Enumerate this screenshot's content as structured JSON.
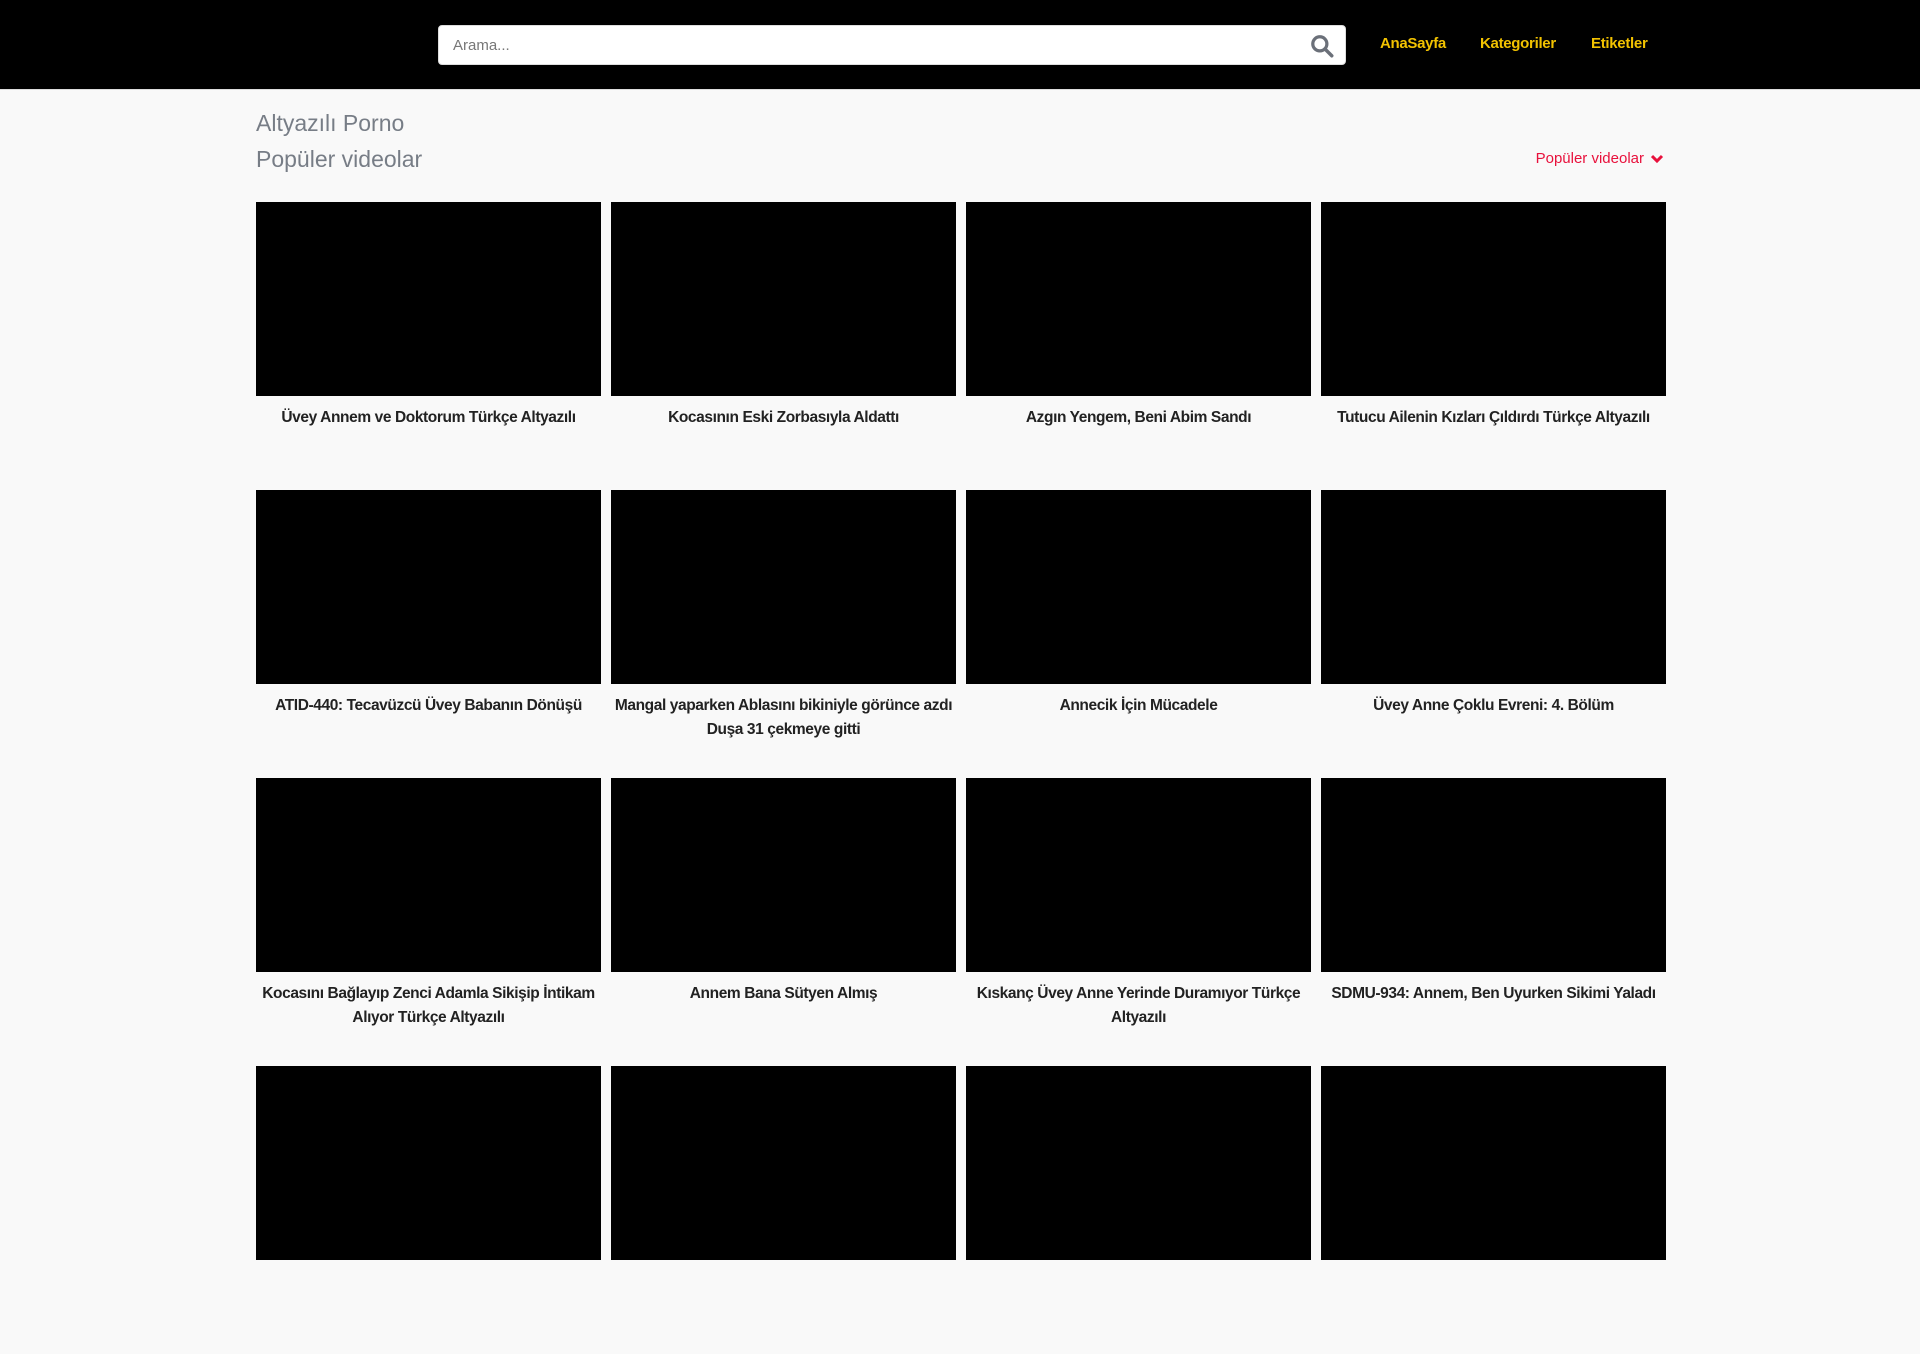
{
  "header": {
    "search_placeholder": "Arama...",
    "nav": [
      "AnaSayfa",
      "Kategoriler",
      "Etiketler"
    ],
    "nav_color": "#f2c200"
  },
  "page": {
    "category_title": "Altyazılı Porno",
    "section_title": "Popüler videolar",
    "sort_label": "Popüler videolar",
    "sort_color": "#e8113c"
  },
  "videos": [
    "Üvey Annem ve Doktorum Türkçe Altyazılı",
    "Kocasının Eski Zorbasıyla Aldattı",
    "Azgın Yengem, Beni Abim Sandı",
    "Tutucu Ailenin Kızları Çıldırdı Türkçe Altyazılı",
    "ATID-440: Tecavüzcü Üvey Babanın Dönüşü",
    "Mangal yaparken Ablasını bikiniyle görünce azdı Duşa 31 çekmeye gitti",
    "Annecik İçin Mücadele",
    "Üvey Anne Çoklu Evreni: 4. Bölüm",
    "Kocasını Bağlayıp Zenci Adamla Sikişip İntikam Alıyor Türkçe Altyazılı",
    "Annem Bana Sütyen Almış",
    "Kıskanç Üvey Anne Yerinde Duramıyor Türkçe Altyazılı",
    "SDMU-934: Annem, Ben Uyurken Sikimi Yaladı"
  ]
}
